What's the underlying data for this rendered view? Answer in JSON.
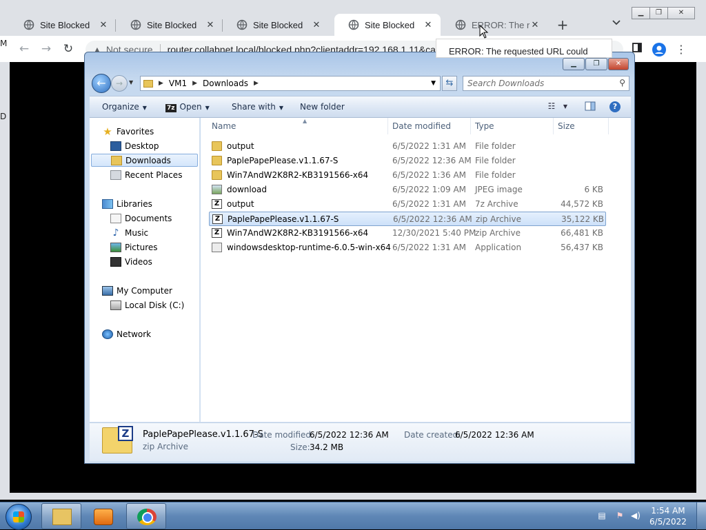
{
  "browser": {
    "tabs": [
      {
        "label": "Site Blocked",
        "close": "✕"
      },
      {
        "label": "Site Blocked",
        "close": "✕"
      },
      {
        "label": "Site Blocked",
        "close": "✕"
      },
      {
        "label": "Site Blocked",
        "close": "✕"
      },
      {
        "label": "ERROR: The requ",
        "close": "✕"
      }
    ],
    "newtab": "+",
    "not_secure": "Not secure",
    "url": "router.collabnet.local/blocked.php?clientaddr=192.168.1.11&ca",
    "tooltip": "ERROR: The requested URL could",
    "left_stub": "M",
    "left_stub2": "D",
    "accent": "#1a73e8"
  },
  "explorer": {
    "breadcrumb": [
      "VM1",
      "Downloads"
    ],
    "search_placeholder": "Search Downloads",
    "commands": {
      "organize": "Organize",
      "open": "Open",
      "open_badge": "7z",
      "share_with": "Share with",
      "new_folder": "New folder"
    },
    "nav": {
      "favorites": "Favorites",
      "desktop": "Desktop",
      "downloads": "Downloads",
      "recent_places": "Recent Places",
      "libraries": "Libraries",
      "documents": "Documents",
      "music": "Music",
      "pictures": "Pictures",
      "videos": "Videos",
      "my_computer": "My Computer",
      "local_disk": "Local Disk (C:)",
      "network": "Network"
    },
    "columns": {
      "name": "Name",
      "date": "Date modified",
      "type": "Type",
      "size": "Size"
    },
    "files": [
      {
        "name": "output",
        "date": "6/5/2022 1:31 AM",
        "type": "File folder",
        "size": "",
        "icon": "folder-icon"
      },
      {
        "name": "PaplePapePlease.v1.1.67-S",
        "date": "6/5/2022 12:36 AM",
        "type": "File folder",
        "size": "",
        "icon": "folder-icon"
      },
      {
        "name": "Win7AndW2K8R2-KB3191566-x64",
        "date": "6/5/2022 1:36 AM",
        "type": "File folder",
        "size": "",
        "icon": "folder-icon"
      },
      {
        "name": "download",
        "date": "6/5/2022 1:09 AM",
        "type": "JPEG image",
        "size": "6 KB",
        "icon": "image-icon"
      },
      {
        "name": "output",
        "date": "6/5/2022 1:31 AM",
        "type": "7z Archive",
        "size": "44,572 KB",
        "icon": "archive-icon"
      },
      {
        "name": "PaplePapePlease.v1.1.67-S",
        "date": "6/5/2022 12:36 AM",
        "type": "zip Archive",
        "size": "35,122 KB",
        "icon": "archive-icon"
      },
      {
        "name": "Win7AndW2K8R2-KB3191566-x64",
        "date": "12/30/2021 5:40 PM",
        "type": "zip Archive",
        "size": "66,481 KB",
        "icon": "archive-icon"
      },
      {
        "name": "windowsdesktop-runtime-6.0.5-win-x64",
        "date": "6/5/2022 1:31 AM",
        "type": "Application",
        "size": "56,437 KB",
        "icon": "application-icon"
      }
    ],
    "archive_glyph": "Z",
    "details": {
      "name": "PaplePapePlease.v1.1.67-S",
      "type": "zip Archive",
      "date_modified_label": "Date modified:",
      "date_modified": "6/5/2022 12:36 AM",
      "size_label": "Size:",
      "size": "34.2 MB",
      "date_created_label": "Date created:",
      "date_created": "6/5/2022 12:36 AM"
    }
  },
  "taskbar": {
    "time": "1:54 AM",
    "date": "6/5/2022"
  }
}
